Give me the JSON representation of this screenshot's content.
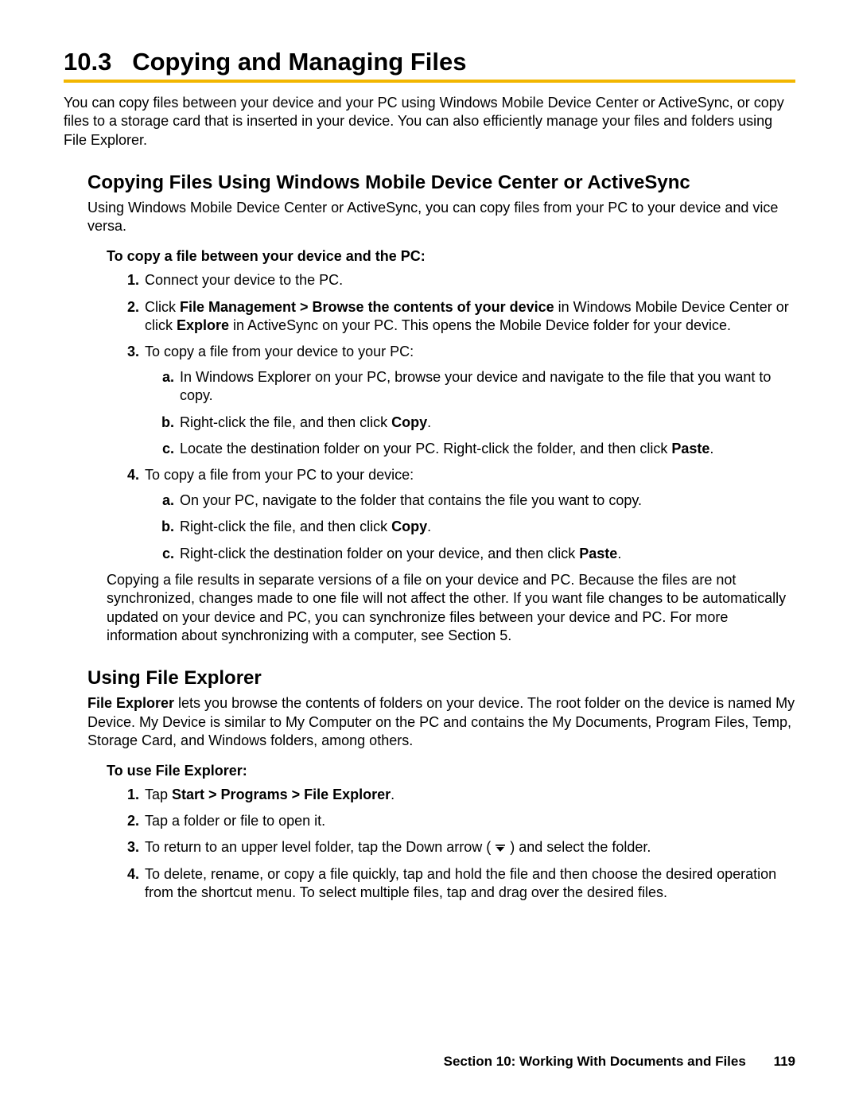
{
  "section_number": "10.3",
  "section_title": "Copying and Managing Files",
  "intro": "You can copy files between your device and your PC using Windows Mobile Device Center or ActiveSync, or copy files to a storage card that is inserted in your device. You can also efficiently manage your files and folders using File Explorer.",
  "sub1": {
    "title": "Copying Files Using Windows Mobile Device Center or ActiveSync",
    "intro": "Using Windows Mobile Device Center or ActiveSync, you can copy files from your PC to your device and vice versa.",
    "howto_label": "To copy a file between your device and the PC:",
    "steps": {
      "s1": "Connect your device to the PC.",
      "s2_a": "Click ",
      "s2_b1": "File Management > Browse the contents of your device",
      "s2_c": " in Windows Mobile Device Center or click ",
      "s2_b2": "Explore",
      "s2_d": " in ActiveSync on your PC. This opens the Mobile Device folder for your device.",
      "s3": "To copy a file from your device to your PC:",
      "s3a": "In Windows Explorer on your PC, browse your device and navigate to the file that you want to copy.",
      "s3b_a": "Right-click the file, and then click ",
      "s3b_b": "Copy",
      "s3b_c": ".",
      "s3c_a": "Locate the destination folder on your PC. Right-click the folder, and then click ",
      "s3c_b": "Paste",
      "s3c_c": ".",
      "s4": "To copy a file from your PC to your device:",
      "s4a": "On your PC, navigate to the folder that contains the file you want to copy.",
      "s4b_a": "Right-click the file, and then click ",
      "s4b_b": "Copy",
      "s4b_c": ".",
      "s4c_a": "Right-click the destination folder on your device, and then click ",
      "s4c_b": "Paste",
      "s4c_c": "."
    },
    "note": "Copying a file results in separate versions of a file on your device and PC. Because the files are not synchronized, changes made to one file will not affect the other. If you want file changes to be automatically updated on your device and PC, you can synchronize files between your device and PC. For more information about synchronizing with a computer, see Section 5."
  },
  "sub2": {
    "title": "Using File Explorer",
    "intro_b": "File Explorer",
    "intro_rest": " lets you browse the contents of folders on your device. The root folder on the device is named My Device. My Device is similar to My Computer on the PC and contains the My Documents, Program Files, Temp, Storage Card, and Windows folders, among others.",
    "howto_label": "To use File Explorer:",
    "steps": {
      "s1_a": "Tap ",
      "s1_b": "Start > Programs > File Explorer",
      "s1_c": ".",
      "s2": "Tap a folder or file to open it.",
      "s3_a": "To return to an upper level folder, tap the Down arrow ( ",
      "s3_b": " ) and select the folder.",
      "s4": "To delete, rename, or copy a file quickly, tap and hold the file and then choose the desired operation from the shortcut menu. To select multiple files, tap and drag over the desired files."
    }
  },
  "footer": {
    "section_label": "Section 10: Working With Documents and Files",
    "page_number": "119"
  }
}
